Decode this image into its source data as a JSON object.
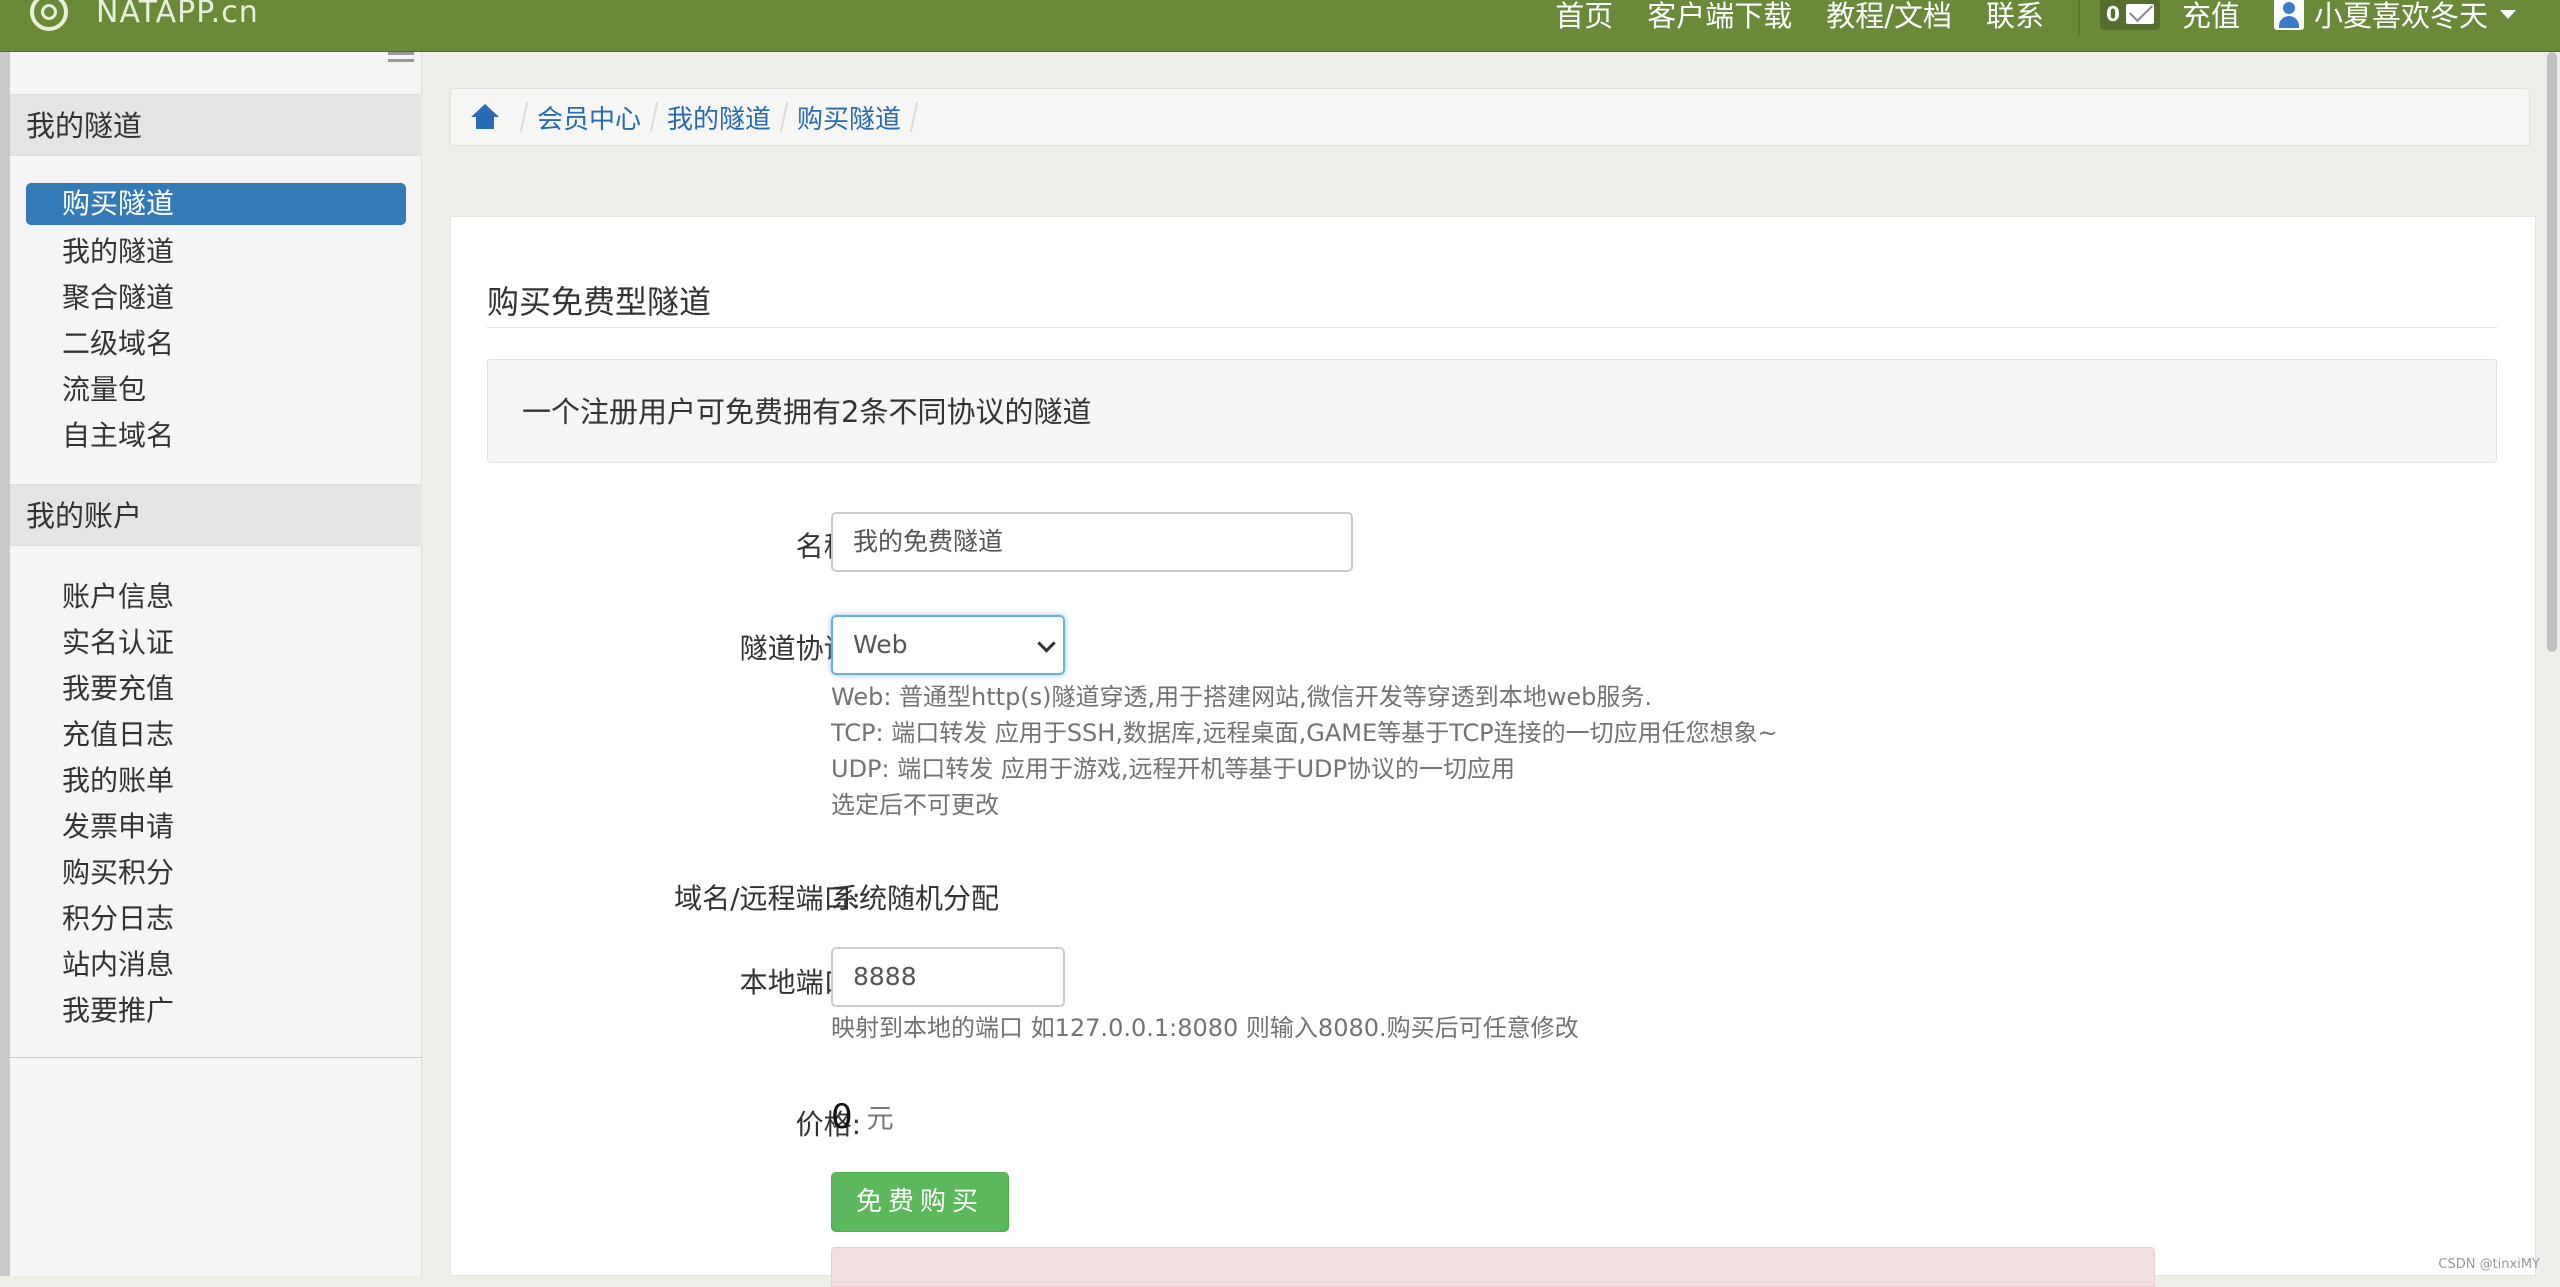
{
  "navbar": {
    "brand": "NATAPP.cn",
    "links": [
      "首页",
      "客户端下载",
      "教程/文档",
      "联系"
    ],
    "mail_count": "0",
    "recharge": "充值",
    "username": "小夏喜欢冬天"
  },
  "sidebar": {
    "tunnels_header": "我的隧道",
    "tunnel_items": [
      "购买隧道",
      "我的隧道",
      "聚合隧道",
      "二级域名",
      "流量包",
      "自主域名"
    ],
    "account_header": "我的账户",
    "account_items": [
      "账户信息",
      "实名认证",
      "我要充值",
      "充值日志",
      "我的账单",
      "发票申请",
      "购买积分",
      "积分日志",
      "站内消息",
      "我要推广"
    ]
  },
  "breadcrumb": [
    "会员中心",
    "我的隧道",
    "购买隧道"
  ],
  "main": {
    "title": "购买免费型隧道",
    "notice": "一个注册用户可免费拥有2条不同协议的隧道",
    "name_label": "名称:",
    "name_value": "我的免费隧道",
    "protocol_label": "隧道协议:",
    "protocol_value": "Web",
    "protocol_help": [
      "Web: 普通型http(s)隧道穿透,用于搭建网站,微信开发等穿透到本地web服务.",
      "TCP: 端口转发 应用于SSH,数据库,远程桌面,GAME等基于TCP连接的一切应用任您想象~",
      "UDP: 端口转发 应用于游戏,远程开机等基于UDP协议的一切应用",
      "选定后不可更改"
    ],
    "domain_label": "域名/远程端口:",
    "domain_value": "系统随机分配",
    "local_port_label": "本地端口:",
    "local_port_value": "8888",
    "local_port_help": "映射到本地的端口 如127.0.0.1:8080 则输入8080.购买后可任意修改",
    "price_label": "价格:",
    "price_value": "0",
    "price_unit": "元",
    "buy_button": "免费购买"
  },
  "watermark": "CSDN @tinxiMY",
  "colors": {
    "navbar": "#6a8a3a",
    "primary": "#337ab7",
    "success": "#5cb85c"
  }
}
